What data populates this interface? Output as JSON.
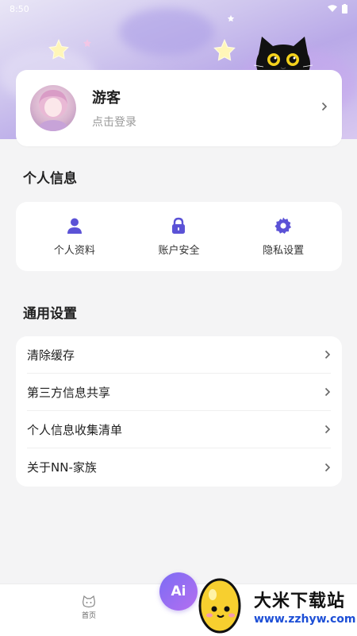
{
  "status_bar": {
    "time": "8:50"
  },
  "profile": {
    "name": "游客",
    "subtitle": "点击登录"
  },
  "personal_info": {
    "title": "个人信息",
    "items": [
      {
        "label": "个人资料",
        "icon": "user-icon"
      },
      {
        "label": "账户安全",
        "icon": "lock-icon"
      },
      {
        "label": "隐私设置",
        "icon": "gear-icon"
      }
    ]
  },
  "general_settings": {
    "title": "通用设置",
    "items": [
      {
        "label": "清除缓存"
      },
      {
        "label": "第三方信息共享"
      },
      {
        "label": "个人信息收集清单"
      },
      {
        "label": "关于NN-家族"
      }
    ]
  },
  "tabbar": {
    "home_label": "首页",
    "ai_label": "Ai"
  },
  "watermark": {
    "title": "大米下载站",
    "url": "www.zzhyw.com"
  },
  "colors": {
    "accent": "#6e5ce0",
    "watermark_url": "#1d4fd6"
  }
}
